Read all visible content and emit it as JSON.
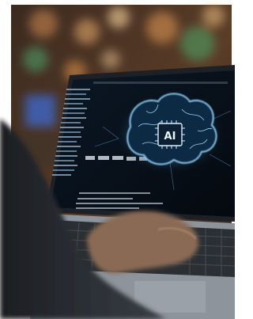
{
  "photo": {
    "subject": "laptop-with-ai-brain-screen",
    "chip_label": "AI",
    "colors": {
      "frame": "#ffffff",
      "cafe_bg_dark": "#2a211c",
      "cafe_bg_warm": "#7a4e2e",
      "bokeh_warm": "#f0a050",
      "bokeh_green": "#4fa86a",
      "bokeh_blue": "#3a6ee0",
      "screen_bg": "#0a1420",
      "brain_glow": "#7ec8ff",
      "chip_fill": "#0d1f33",
      "laptop_body": "#9aa2aa",
      "keyboard": "#2b2f33",
      "hand": "#8a6a55",
      "sleeve": "#2a2d33"
    }
  }
}
